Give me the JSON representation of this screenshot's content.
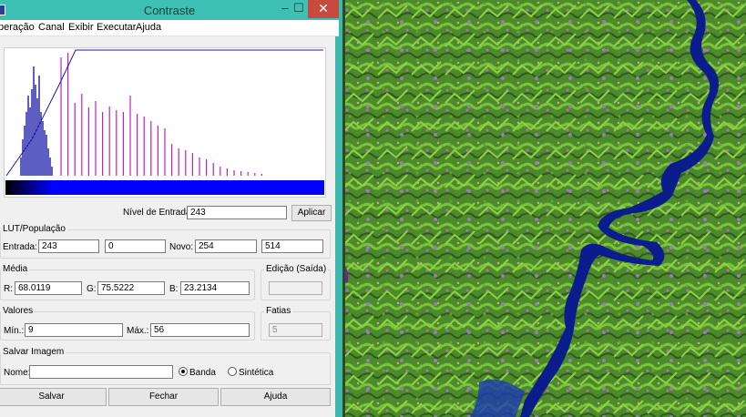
{
  "window": {
    "title": "Contraste",
    "minimize_glyph": "‒",
    "maximize_glyph": "☐",
    "close_glyph": "✕"
  },
  "menu": [
    "peração",
    "Canal",
    "Exibir",
    "Executar",
    "Ajuda"
  ],
  "histogram": {
    "transfer_curve_color": "#1a1aa8",
    "bar_colors": [
      "#1a1aa8",
      "#c020c0"
    ],
    "gradient": [
      "#000000",
      "#0000ff"
    ]
  },
  "entrada": {
    "label": "Nível de Entrada:",
    "value": "243",
    "apply_label": "Aplicar"
  },
  "lut": {
    "title": "LUT/População",
    "entrada_label": "Entrada:",
    "entrada_value": "243",
    "pop_value": "0",
    "novo_label": "Novo:",
    "novo_value": "254",
    "novo_pop_value": "514"
  },
  "media": {
    "title": "Média",
    "r_label": "R:",
    "r_value": "68.0119",
    "g_label": "G:",
    "g_value": "75.5222",
    "b_label": "B:",
    "b_value": "23.2134"
  },
  "edicao": {
    "title": "Edição (Saída)",
    "value": ""
  },
  "valores": {
    "title": "Valores",
    "min_label": "Mín.:",
    "min_value": "9",
    "max_label": "Máx.:",
    "max_value": "56"
  },
  "fatias": {
    "title": "Fatias",
    "value": "5"
  },
  "salvar_imagem": {
    "title": "Salvar Imagem",
    "nome_label": "Nome:",
    "nome_value": "",
    "banda_label": "Banda",
    "sintetica_label": "Sintética",
    "selected": "Banda"
  },
  "buttons": {
    "salvar": "Salvar",
    "fechar": "Fechar",
    "ajuda": "Ajuda"
  },
  "colors": {
    "titlebar": "#3fc0b4",
    "close": "#c84a3e",
    "river": "#0a1a8a",
    "vegetation": "#4f8a2a"
  }
}
